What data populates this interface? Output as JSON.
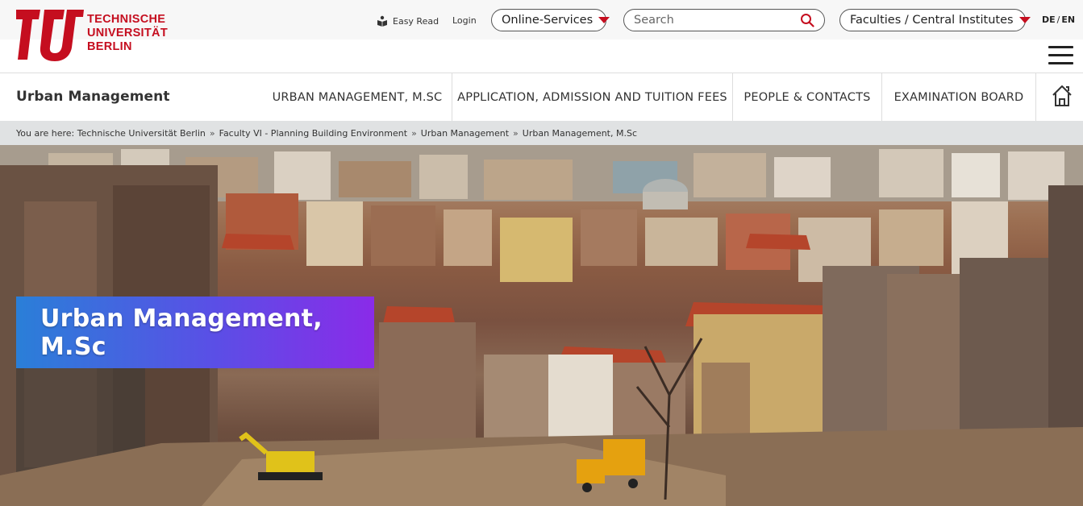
{
  "brand": {
    "logo_lines": [
      "TECHNISCHE",
      "UNIVERSITÄT",
      "BERLIN"
    ],
    "color": "#c50e1f"
  },
  "header": {
    "easy_read": "Easy Read",
    "login": "Login",
    "online_services": "Online-Services",
    "search_placeholder": "Search",
    "faculties": "Faculties / Central Institutes",
    "lang_de": "DE",
    "lang_sep": "/",
    "lang_en": "EN"
  },
  "nav": {
    "site_title": "Urban Management",
    "items": [
      "URBAN MANAGEMENT, M.SC",
      "APPLICATION, ADMISSION AND TUITION FEES",
      "PEOPLE & CONTACTS",
      "EXAMINATION BOARD"
    ]
  },
  "breadcrumb": {
    "prefix": "You are here:",
    "items": [
      "Technische Universität Berlin",
      "Faculty VI - Planning Building Environment",
      "Urban Management",
      "Urban Management, M.Sc"
    ],
    "separator": "»"
  },
  "hero": {
    "title": "Urban Management, M.Sc",
    "gradient_start": "#2a7fd8",
    "gradient_end": "#8a2be8"
  },
  "icons": {
    "easy_read": "easy-read-icon",
    "search": "search-icon",
    "caret": "caret-down-icon",
    "menu": "hamburger-menu-icon",
    "home": "home-icon"
  }
}
